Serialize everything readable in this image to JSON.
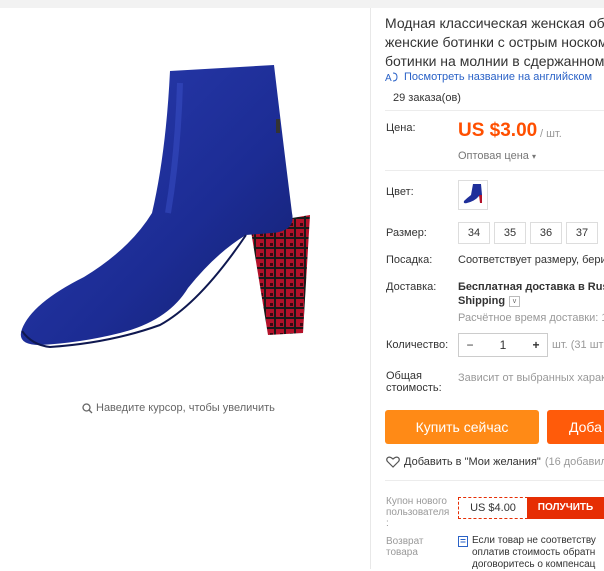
{
  "title_lines": [
    "Модная классическая женская обув",
    "женские ботинки с острым носком, ",
    "ботинки на молнии в сдержанном с"
  ],
  "translate_link": "Посмотреть название на английском",
  "orders": "29 заказа(ов)",
  "price_label": "Цена:",
  "price": "US $3.00",
  "price_unit": "/ шт.",
  "wholesale": "Оптовая цена",
  "color_label": "Цвет:",
  "size_label": "Размер:",
  "sizes": [
    "34",
    "35",
    "36",
    "37"
  ],
  "fit_label": "Посадка:",
  "fit_value": "Соответствует размеру, берит",
  "shipping_label": "Доставка:",
  "shipping_value_1": "Бесплатная доставка в Russ",
  "shipping_value_2": "Shipping",
  "shipping_eta": "Расчётное время доставки: 1",
  "qty_label": "Количество:",
  "qty_minus": "−",
  "qty_value": "1",
  "qty_plus": "+",
  "qty_note": "шт. (31 шт",
  "total_label_1": "Общая",
  "total_label_2": "стоимость:",
  "total_value": "Зависит от выбранных характ",
  "buy_now": "Купить сейчас",
  "add_to_cart": "Доба",
  "wishlist": "Добавить в \"Мои желания\"",
  "wishlist_count": "(16 добавили",
  "coupon_label_1": "Купон нового",
  "coupon_label_2": "пользователя",
  "coupon_label_3": ":",
  "coupon_amount": "US $4.00",
  "coupon_button": "ПОЛУЧИТЬ",
  "return_label_1": "Возврат",
  "return_label_2": "товара",
  "return_text_1": "Если товар не соответству",
  "return_text_2": "оплатив стоимость обратн",
  "return_text_3": "договоритесь о компенсац",
  "zoom_hint": "Наведите курсор, чтобы увеличить",
  "colors": {
    "accent_price": "#ff4f00",
    "buy_button": "#ff8a16",
    "cart_button": "#ff5b0a",
    "coupon": "#e62e04",
    "link": "#2a62c7",
    "boot": "#1f2f9a"
  },
  "icons": {
    "translate": "translate-icon",
    "zoom": "magnifier-icon",
    "wishlist": "heart-icon",
    "chevron": "chevron-down-icon",
    "return": "document-icon"
  }
}
